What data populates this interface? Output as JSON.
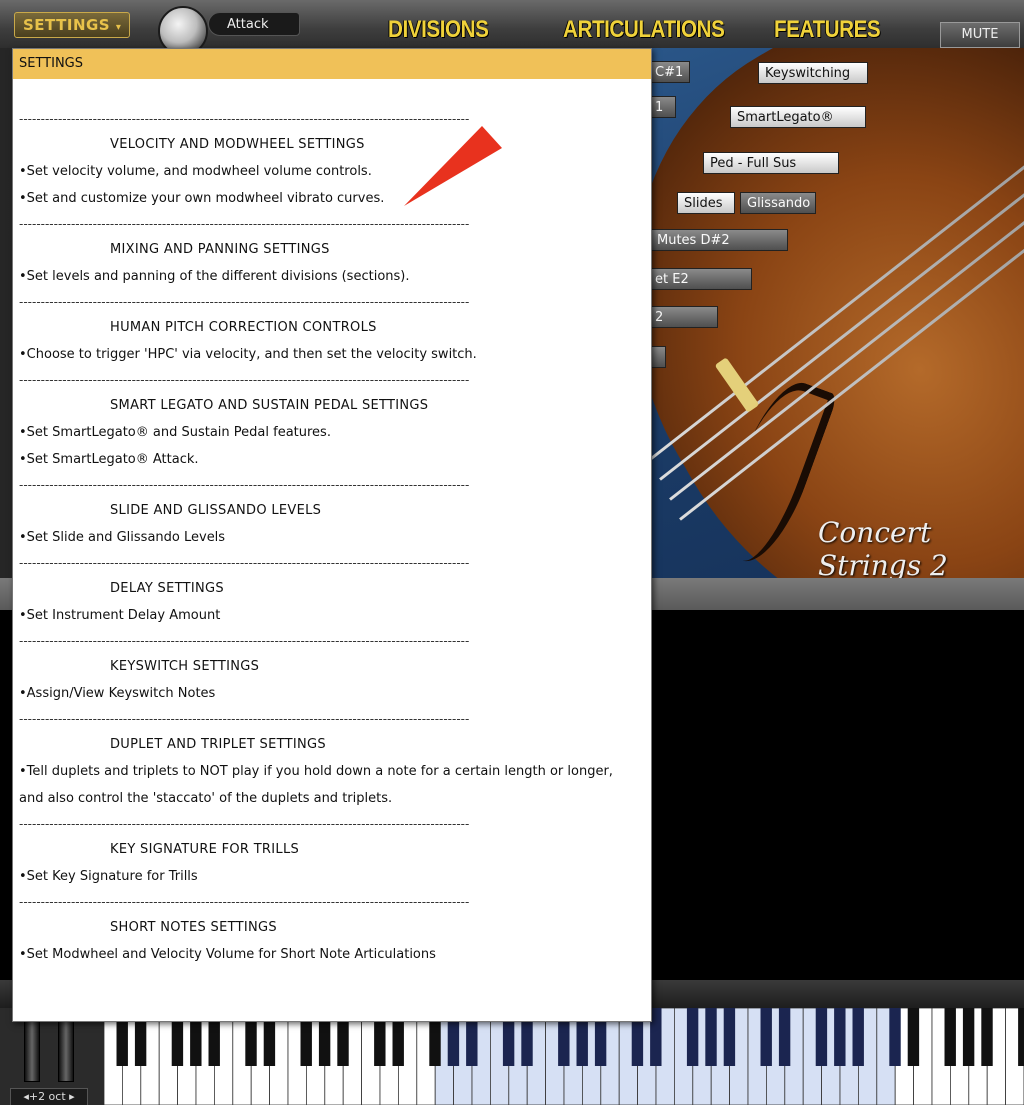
{
  "header": {
    "settings_label": "SETTINGS",
    "attack_label": "Attack",
    "tabs": [
      "DIVISIONS",
      "ARTICULATIONS",
      "FEATURES"
    ],
    "mute_label": "MUTE"
  },
  "panel": {
    "buttons": {
      "key_c1": "C#1",
      "keyswitching": "Keyswitching",
      "k1": "1",
      "smartlegato": "SmartLegato®",
      "ped": "Ped - Full Sus",
      "slides": "Slides",
      "glissando": "Glissando",
      "mutes": "Mutes D#2",
      "et_e2": "et E2",
      "k2": "2"
    },
    "logo_text": "Concert Strings 2"
  },
  "keyboard": {
    "octave_label": "◂+2 oct ▸"
  },
  "popup": {
    "title": "SETTINGS",
    "separator": "--------------------------------------------------------------------------------------------------------",
    "sections": [
      {
        "title": "VELOCITY AND MODWHEEL SETTINGS",
        "lines": [
          "•Set velocity volume, and modwheel volume controls.",
          "•Set and customize your own modwheel vibrato curves."
        ]
      },
      {
        "title": "MIXING AND PANNING SETTINGS",
        "lines": [
          "•Set levels and panning of the different divisions (sections)."
        ]
      },
      {
        "title": "HUMAN PITCH CORRECTION CONTROLS",
        "lines": [
          "•Choose to trigger 'HPC' via velocity, and then set the velocity switch."
        ]
      },
      {
        "title": "SMART LEGATO AND SUSTAIN PEDAL SETTINGS",
        "lines": [
          "•Set SmartLegato® and Sustain Pedal features.",
          "•Set SmartLegato® Attack."
        ]
      },
      {
        "title": "SLIDE AND GLISSANDO LEVELS",
        "lines": [
          "•Set Slide and Glissando Levels"
        ]
      },
      {
        "title": "DELAY SETTINGS",
        "lines": [
          "•Set Instrument Delay Amount"
        ]
      },
      {
        "title": "KEYSWITCH SETTINGS",
        "lines": [
          "•Assign/View Keyswitch Notes"
        ]
      },
      {
        "title": "DUPLET AND TRIPLET SETTINGS",
        "lines": [
          "•Tell duplets and triplets to NOT play if you hold down a note for a certain length or longer,",
          "and also control the 'staccato' of the duplets and triplets."
        ]
      },
      {
        "title": "KEY SIGNATURE FOR TRILLS",
        "lines": [
          "•Set Key Signature for Trills"
        ]
      },
      {
        "title": "SHORT NOTES SETTINGS",
        "lines": [
          "•Set Modwheel and Velocity Volume for Short Note Articulations"
        ]
      }
    ]
  },
  "colors": {
    "popup_title_bg": "#f0c158",
    "tab_yellow": "#f0d23a",
    "annotation_arrow": "#e8321e"
  }
}
